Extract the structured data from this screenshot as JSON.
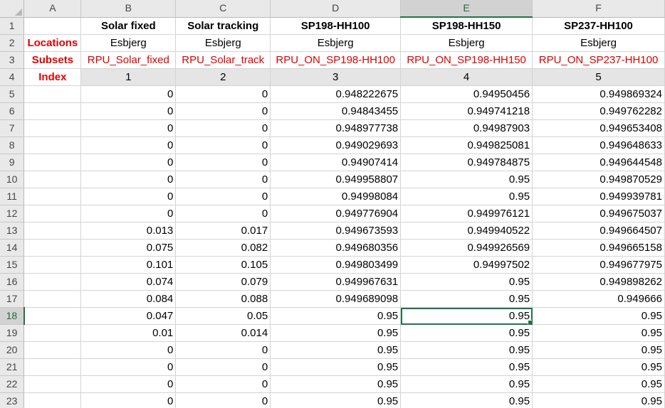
{
  "columns": [
    "A",
    "B",
    "C",
    "D",
    "E",
    "F"
  ],
  "selected_column": "E",
  "selected_row": "18",
  "headers": {
    "b": "Solar fixed",
    "c": "Solar tracking",
    "d": "SP198-HH100",
    "e": "SP198-HH150",
    "f": "SP237-HH100"
  },
  "locations": {
    "label": "Locations",
    "b": "Esbjerg",
    "c": "Esbjerg",
    "d": "Esbjerg",
    "e": "Esbjerg",
    "f": "Esbjerg"
  },
  "subsets": {
    "label": "Subsets",
    "b": "RPU_Solar_fixed",
    "c": "RPU_Solar_track",
    "d": "RPU_ON_SP198-HH100",
    "e": "RPU_ON_SP198-HH150",
    "f": "RPU_ON_SP237-HH100"
  },
  "index": {
    "label": "Index",
    "b": "1",
    "c": "2",
    "d": "3",
    "e": "4",
    "f": "5"
  },
  "rows": [
    {
      "num": "1"
    },
    {
      "num": "2"
    },
    {
      "num": "3"
    },
    {
      "num": "4"
    },
    {
      "num": "5",
      "b": "0",
      "c": "0",
      "d": "0.948222675",
      "e": "0.94950456",
      "f": "0.949869324"
    },
    {
      "num": "6",
      "b": "0",
      "c": "0",
      "d": "0.94843455",
      "e": "0.949741218",
      "f": "0.949762282"
    },
    {
      "num": "7",
      "b": "0",
      "c": "0",
      "d": "0.948977738",
      "e": "0.94987903",
      "f": "0.949653408"
    },
    {
      "num": "8",
      "b": "0",
      "c": "0",
      "d": "0.949029693",
      "e": "0.949825081",
      "f": "0.949648633"
    },
    {
      "num": "9",
      "b": "0",
      "c": "0",
      "d": "0.94907414",
      "e": "0.949784875",
      "f": "0.949644548"
    },
    {
      "num": "10",
      "b": "0",
      "c": "0",
      "d": "0.949958807",
      "e": "0.95",
      "f": "0.949870529"
    },
    {
      "num": "11",
      "b": "0",
      "c": "0",
      "d": "0.94998084",
      "e": "0.95",
      "f": "0.949939781"
    },
    {
      "num": "12",
      "b": "0",
      "c": "0",
      "d": "0.949776904",
      "e": "0.949976121",
      "f": "0.949675037"
    },
    {
      "num": "13",
      "b": "0.013",
      "c": "0.017",
      "d": "0.949673593",
      "e": "0.949940522",
      "f": "0.949664507"
    },
    {
      "num": "14",
      "b": "0.075",
      "c": "0.082",
      "d": "0.949680356",
      "e": "0.949926569",
      "f": "0.949665158"
    },
    {
      "num": "15",
      "b": "0.101",
      "c": "0.105",
      "d": "0.949803499",
      "e": "0.94997502",
      "f": "0.949677975"
    },
    {
      "num": "16",
      "b": "0.074",
      "c": "0.079",
      "d": "0.949967631",
      "e": "0.95",
      "f": "0.949898262"
    },
    {
      "num": "17",
      "b": "0.084",
      "c": "0.088",
      "d": "0.949689098",
      "e": "0.95",
      "f": "0.949666"
    },
    {
      "num": "18",
      "b": "0.047",
      "c": "0.05",
      "d": "0.95",
      "e": "0.95",
      "f": "0.95"
    },
    {
      "num": "19",
      "b": "0.01",
      "c": "0.014",
      "d": "0.95",
      "e": "0.95",
      "f": "0.95"
    },
    {
      "num": "20",
      "b": "0",
      "c": "0",
      "d": "0.95",
      "e": "0.95",
      "f": "0.95"
    },
    {
      "num": "21",
      "b": "0",
      "c": "0",
      "d": "0.95",
      "e": "0.95",
      "f": "0.95"
    },
    {
      "num": "22",
      "b": "0",
      "c": "0",
      "d": "0.95",
      "e": "0.95",
      "f": "0.95"
    },
    {
      "num": "23",
      "b": "0",
      "c": "0",
      "d": "0.95",
      "e": "0.95",
      "f": "0.95"
    }
  ]
}
